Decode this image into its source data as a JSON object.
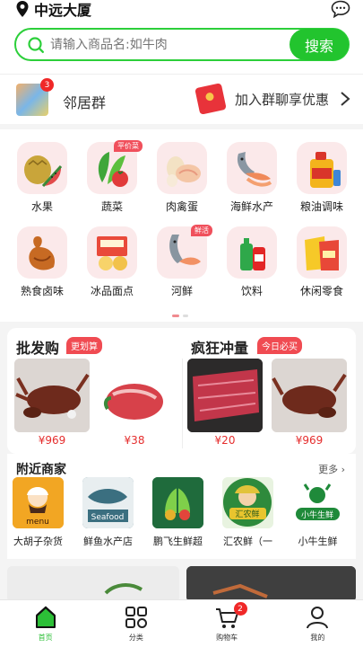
{
  "header": {
    "location": "中远大厦"
  },
  "search": {
    "placeholder": "请输入商品名:如牛肉",
    "button": "搜索"
  },
  "neighbor": {
    "group_label": "邻居群",
    "badge": "3",
    "join_text": "加入群聊享优惠"
  },
  "categories": [
    {
      "label": "水果",
      "tag": ""
    },
    {
      "label": "蔬菜",
      "tag": "平价菜"
    },
    {
      "label": "肉禽蛋",
      "tag": ""
    },
    {
      "label": "海鲜水产",
      "tag": ""
    },
    {
      "label": "粮油调味",
      "tag": ""
    },
    {
      "label": "熟食卤味",
      "tag": ""
    },
    {
      "label": "冰品面点",
      "tag": ""
    },
    {
      "label": "河鲜",
      "tag": "鲜活"
    },
    {
      "label": "饮料",
      "tag": ""
    },
    {
      "label": "休闲零食",
      "tag": ""
    }
  ],
  "deals": {
    "wholesale": {
      "title": "批发购",
      "tag": "更划算",
      "prices": [
        "¥969",
        "¥38"
      ]
    },
    "crazy": {
      "title": "疯狂冲量",
      "tag": "今日必买",
      "prices": [
        "¥20",
        "¥969"
      ]
    }
  },
  "nearby": {
    "title": "附近商家",
    "more": "更多",
    "shops": [
      {
        "name": "大胡子杂货",
        "logo_text": "menu"
      },
      {
        "name": "鲜鱼水产店",
        "logo_text": "Seafood"
      },
      {
        "name": "鹏飞生鲜超",
        "logo_text": ""
      },
      {
        "name": "汇农鲜（一",
        "logo_text": "汇农鲜"
      },
      {
        "name": "小牛生鲜",
        "logo_text": "小牛生鲜"
      }
    ]
  },
  "tabs": [
    {
      "label": "首页",
      "icon": "home-icon"
    },
    {
      "label": "分类",
      "icon": "grid-icon"
    },
    {
      "label": "购物车",
      "icon": "cart-icon",
      "badge": "2"
    },
    {
      "label": "我的",
      "icon": "user-icon"
    }
  ],
  "colors": {
    "brand": "#22c42e",
    "price": "#e52d2d",
    "badge": "#f02828"
  }
}
